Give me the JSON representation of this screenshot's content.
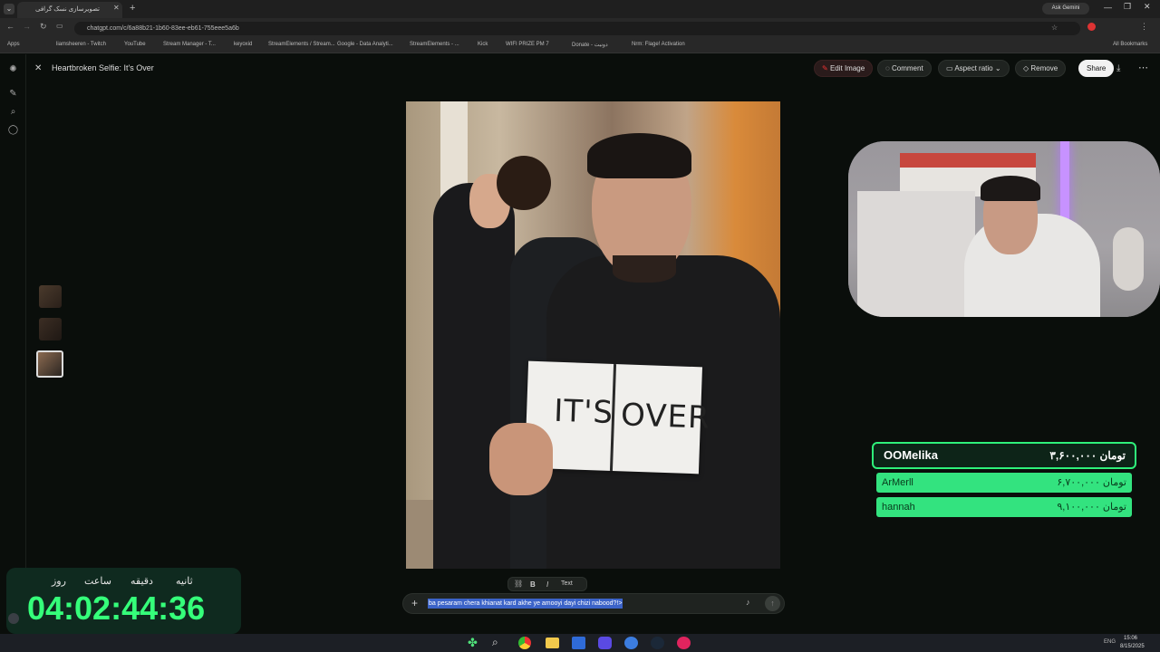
{
  "browser": {
    "tab_title": "تصویرسازی نسک گرافی",
    "url": "chatgpt.com/c/6a88b21-1b60-83ee-eb61-755eee5a6b",
    "ask_gemini": "Ask Gemini",
    "bookmarks": [
      "Apps",
      "liamsheeren - Twitch",
      "YouTube",
      "Stream Manager - T...",
      "keyoxid",
      "StreamElements / Stream...",
      "Google - Data Analyti...",
      "StreamElements - ...",
      "Kick",
      "WIFI PRIZE PM 7",
      "Donate - دونیت",
      "Nrm: Flage! Activation"
    ],
    "all_bookmarks": "All Bookmarks"
  },
  "chat": {
    "image_title": "Heartbroken Selfie: It's Over",
    "edit_image": "Edit Image",
    "comment": "Comment",
    "aspect_ratio": "Aspect ratio",
    "remove": "Remove",
    "share": "Share",
    "prompt_text": "ba pesaram chera khianat kard akhe ye amooyi dayi chizi nabood?!>",
    "format_text": "Text",
    "format_bold": "B",
    "format_italic": "I"
  },
  "photo": {
    "sign_left": "IT'S",
    "sign_right": "OVER"
  },
  "donations": [
    {
      "name": "OOMelika",
      "amount": "تومان ۳,۶۰۰,۰۰۰"
    },
    {
      "name": "ArMerll",
      "amount": "تومان ۶,۷۰۰,۰۰۰"
    },
    {
      "name": "hannah",
      "amount": "تومان ۹,۱۰۰,۰۰۰"
    }
  ],
  "timer": {
    "labels": [
      "روز",
      "ساعت",
      "دقیقه",
      "ثانیه"
    ],
    "value": "04:02:44:36"
  },
  "taskbar": {
    "time": "15:06",
    "date": "8/15/2025",
    "lang": "ENG"
  },
  "colors": {
    "accent_green": "#2ef07a",
    "donation_green": "#33e37f",
    "timer_green": "#35ff7a"
  }
}
